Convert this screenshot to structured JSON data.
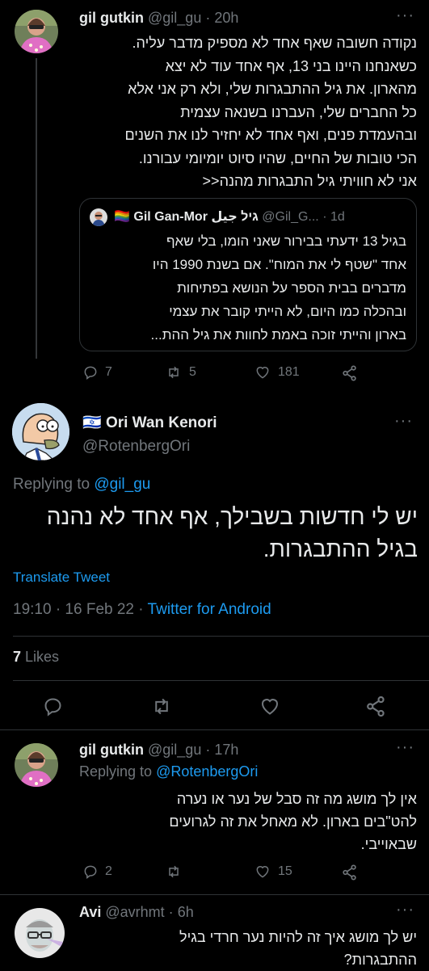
{
  "colors": {
    "accent": "#1d9bf0",
    "text": "#e7e9ea",
    "muted": "#71767b",
    "divider": "#2f3336"
  },
  "tweet1": {
    "name": "gil gutkin",
    "handle": "@gil_gu",
    "time": "20h",
    "lines": [
      "נקודה חשובה שאף אחד לא מספיק מדבר עליה.",
      "כשאנחנו היינו בני 13, אף אחד עוד לא יצא",
      "מהארון. את גיל ההתבגרות שלי, ולא רק אני אלא",
      "כל החברים שלי, העברנו בשנאה עצמית",
      "ובהעמדת פנים, ואף אחד לא יחזיר לנו את השנים",
      "הכי טובות של החיים, שהיו סיוט יומיומי עבורנו.",
      "אני לא חוויתי גיל התבגרות מהנה<<"
    ],
    "quote": {
      "rainbow": "🏳️‍🌈",
      "name": "Gil Gan-Mor גיל جيل",
      "handle": "@Gil_G...",
      "time": "1d",
      "lines": [
        "בגיל 13 ידעתי בבירור שאני הומו, בלי שאף",
        "אחד \"שטף לי את המוח\". אם בשנת 1990 היו",
        "מדברים בבית הספר על הנושא בפתיחות",
        "ובהכלה כמו היום, לא הייתי קובר את עצמי",
        "בארון והייתי זוכה באמת לחוות את גיל ההת..."
      ]
    },
    "replies": "7",
    "retweets": "5",
    "likes": "181"
  },
  "main": {
    "flag": "🇮🇱",
    "name": "Ori Wan Kenori",
    "handle": "@RotenbergOri",
    "replying_prefix": "Replying to ",
    "replying_to": "@gil_gu",
    "lines": [
      "יש לי חדשות בשבילך, אף אחד לא נהנה",
      "בגיל ההתבגרות."
    ],
    "translate": "Translate Tweet",
    "timestamp": "19:10 · 16 Feb 22 · ",
    "source": "Twitter for Android",
    "likes_count": "7",
    "likes_label": " Likes"
  },
  "reply1": {
    "name": "gil gutkin",
    "handle": "@gil_gu",
    "time": "17h",
    "replying_prefix": "Replying to ",
    "replying_to": "@RotenbergOri",
    "lines": [
      "אין לך מושג מה זה סבל של נער או נערה",
      "להט\"בים בארון. לא מאחל את זה לגרועים",
      "שבאוייבי."
    ],
    "replies": "2",
    "likes": "15"
  },
  "reply2": {
    "name": "Avi",
    "handle": "@avrhmt",
    "time": "6h",
    "lines": [
      "יש לך מושג איך זה להיות נער חרדי בגיל",
      "ההתבגרות?"
    ]
  }
}
